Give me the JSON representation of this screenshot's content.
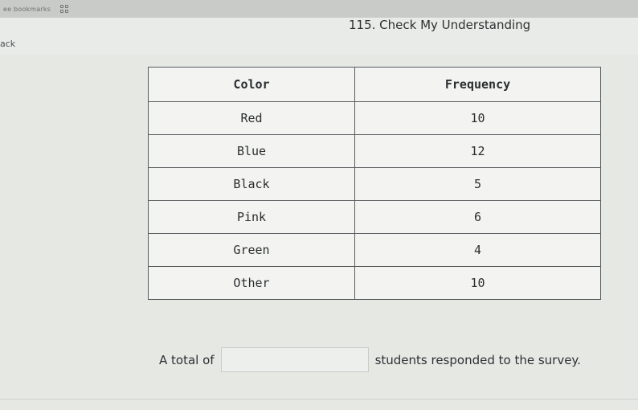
{
  "topbar": {
    "bookmarks_text": "ee bookmarks"
  },
  "header": {
    "back_label": "ack",
    "title": "115. Check My Understanding"
  },
  "table": {
    "headers": [
      "Color",
      "Frequency"
    ],
    "rows": [
      {
        "color": "Red",
        "frequency": "10"
      },
      {
        "color": "Blue",
        "frequency": "12"
      },
      {
        "color": "Black",
        "frequency": "5"
      },
      {
        "color": "Pink",
        "frequency": "6"
      },
      {
        "color": "Green",
        "frequency": "4"
      },
      {
        "color": "Other",
        "frequency": "10"
      }
    ]
  },
  "question": {
    "prefix": "A total of",
    "answer_value": "",
    "suffix": "students responded to the survey."
  }
}
